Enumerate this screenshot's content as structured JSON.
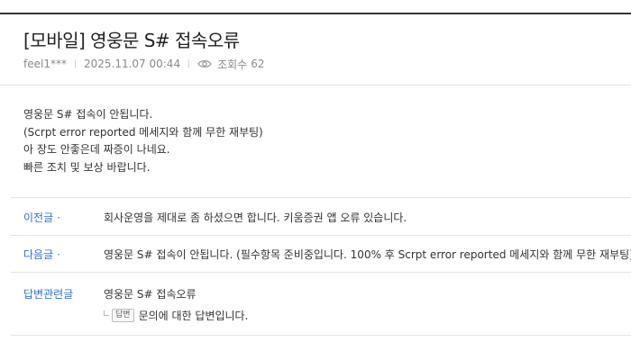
{
  "post": {
    "title": "[모바일] 영웅문 S# 접속오류",
    "author": "feel1***",
    "date": "2025.11.07 00:44",
    "views_label": "조회수",
    "views": "62",
    "body_lines": [
      "영웅문 S# 접속이 안됩니다.",
      "(Scrpt error reported 메세지와 함께 무한 재부팅)",
      "아 장도 안좋은데 짜증이 나네요.",
      "빠른 조치 및 보상 바랍니다."
    ]
  },
  "nav": {
    "prev_label": "이전글",
    "prev_title": "회사운영을 제대로 좀 하셨으면 합니다. 키움증권 앱 오류 있습니다.",
    "next_label": "다음글",
    "next_title": "영웅문 S# 접속이 안됩니다. (필수항목 준비중입니다. 100% 후 Scrpt error reported 메세지와 함께 무한 재부팅)",
    "dot": "·"
  },
  "related": {
    "label": "답변관련글",
    "original_title": "영웅문 S# 접속오류",
    "reply_badge": "답변",
    "reply_title": "문의에 대한 답변입니다."
  },
  "icons": {
    "views": "eye-icon",
    "reply": "reply-arrow-icon"
  },
  "colors": {
    "link_label": "#2f6fd6",
    "meta_text": "#8a8a8a"
  }
}
